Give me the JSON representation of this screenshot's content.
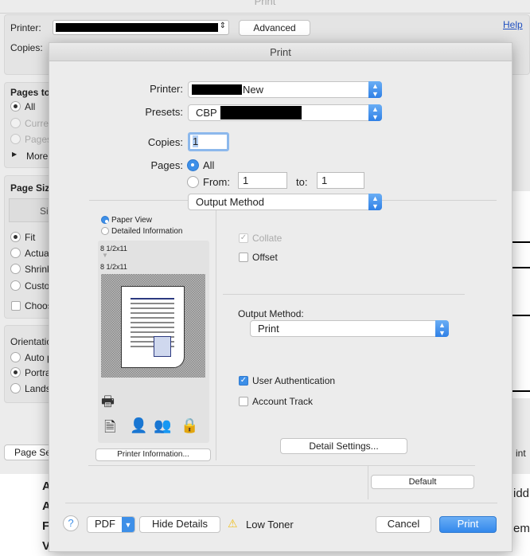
{
  "background_window": {
    "title": "Print",
    "printer_label": "Printer:",
    "advanced_button": "Advanced",
    "help_link": "Help",
    "copies_label": "Copies:",
    "pages_to_print": {
      "heading": "Pages to",
      "options": [
        "All",
        "Curre",
        "Pages"
      ],
      "more": "More"
    },
    "page_size": {
      "heading": "Page Siz",
      "size_button": "Si",
      "options": [
        "Fit",
        "Actua",
        "Shrink",
        "Custo"
      ],
      "choose": "Choos"
    },
    "orientation": {
      "heading": "Orientatio",
      "options": [
        "Auto p",
        "Portra",
        "Lands"
      ]
    },
    "page_setup_button": "Page Se",
    "print_button_partial": "int",
    "doc_text_left": [
      "A",
      "A",
      "F",
      "V"
    ],
    "doc_text_right": [
      "iddl",
      "eme"
    ]
  },
  "dialog": {
    "title": "Print",
    "printer_label": "Printer:",
    "printer_value": "New",
    "presets_label": "Presets:",
    "presets_value": "CBP",
    "copies_label": "Copies:",
    "copies_value": "1",
    "pages_label": "Pages:",
    "pages_all": "All",
    "pages_from": "From:",
    "from_value": "1",
    "to_label": "to:",
    "to_value": "1",
    "panel_select": "Output Method",
    "preview": {
      "paper_view": "Paper View",
      "detailed_info": "Detailed Information",
      "size_in": "8 1/2x11",
      "size_out": "8 1/2x11",
      "printer_info_button": "Printer Information..."
    },
    "collate": "Collate",
    "offset": "Offset",
    "output_method_label": "Output Method:",
    "output_method_value": "Print",
    "user_auth": "User Authentication",
    "account_track": "Account Track",
    "detail_settings_button": "Detail Settings...",
    "default_button": "Default",
    "help_button": "?",
    "pdf_button": "PDF",
    "hide_details_button": "Hide Details",
    "status": "Low Toner",
    "cancel_button": "Cancel",
    "print_button": "Print"
  },
  "colors": {
    "accent": "#3d8fe8",
    "warning": "#f0c020"
  }
}
